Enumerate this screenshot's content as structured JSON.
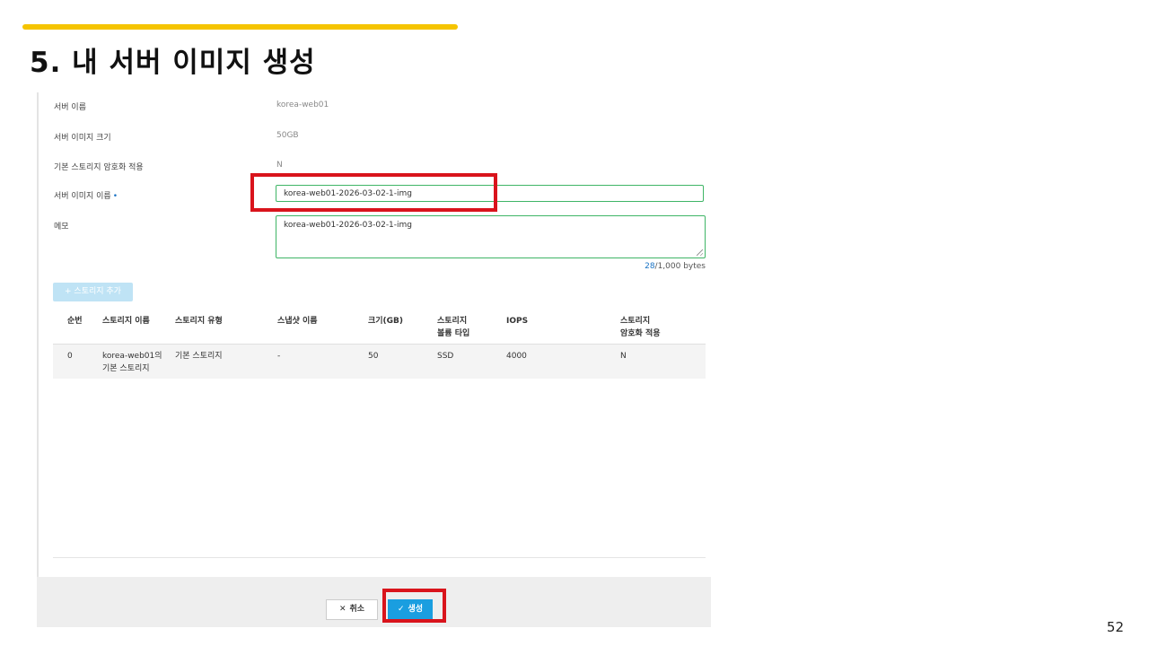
{
  "slide": {
    "title": "5. 내 서버 이미지 생성",
    "page_number": "52"
  },
  "form": {
    "server_name_label": "서버 이름",
    "server_name_value": "korea-web01",
    "image_size_label": "서버 이미지 크기",
    "image_size_value": "50GB",
    "encryption_label": "기본 스토리지 암호화 적용",
    "encryption_value": "N",
    "image_name_label": "서버 이미지 이름",
    "required_mark": "•",
    "image_name_value": "korea-web01-2026-03-02-1-img",
    "memo_label": "메모",
    "memo_value": "korea-web01-2026-03-02-1-img",
    "byte_count_current": "28",
    "byte_count_total": "/1,000 bytes"
  },
  "storage": {
    "add_button_icon": "plus-icon",
    "add_button_label": "+ 스토리지 추가",
    "columns": [
      "순번",
      "스토리지 이름",
      "스토리지 유형",
      "스냅샷 이름",
      "크기(GB)",
      "스토리지\n볼륨 타입",
      "IOPS",
      "스토리지\n암호화 적용"
    ],
    "rows": [
      [
        "0",
        "korea-web01의\n기본 스토리지",
        "기본 스토리지",
        "-",
        "50",
        "SSD",
        "4000",
        "N"
      ]
    ]
  },
  "footer": {
    "cancel_icon": "close-icon",
    "cancel_label": "취소",
    "create_icon": "check-icon",
    "create_label": "생성"
  },
  "colors": {
    "accent_bar": "#f5c400",
    "highlight": "#d9141c",
    "input_border": "#3fb566",
    "primary_button": "#1a9ee0",
    "counter_current": "#1a73c4"
  }
}
